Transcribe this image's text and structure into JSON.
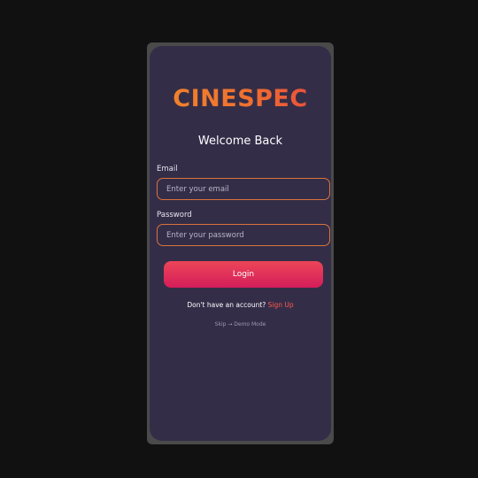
{
  "app": {
    "logo_text": "CINESPEC"
  },
  "login": {
    "title": "Welcome Back",
    "email_label": "Email",
    "email_placeholder": "Enter your email",
    "password_label": "Password",
    "password_placeholder": "Enter your password",
    "login_button": "Login",
    "no_account_text": "Don't have an account?",
    "signup_link": "Sign Up",
    "skip_text": "Skip → Demo Mode"
  },
  "colors": {
    "background": "#111111",
    "screen": "#342d48",
    "accent_orange": "#f0862a",
    "field_border": "#d9743a",
    "button_gradient_start": "#ec4658",
    "button_gradient_end": "#d41d5a",
    "signup_link": "#ff5a4a"
  }
}
